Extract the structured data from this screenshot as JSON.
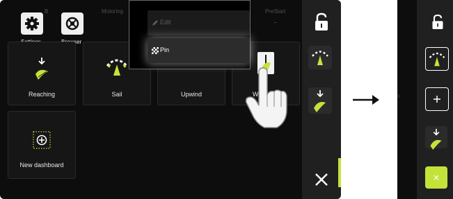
{
  "dashboard": {
    "dim_tabs": [
      "B",
      "Motoring",
      "PreStart"
    ],
    "toolbar": {
      "settings_label": "Settings",
      "browser_label": "Browser"
    },
    "tiles": [
      {
        "label": "Reaching"
      },
      {
        "label": "Sail"
      },
      {
        "label": "Upwind"
      },
      {
        "label": "Windrace"
      },
      {
        "label": "New dashboard"
      }
    ]
  },
  "context_menu": {
    "edit_label": "Edit",
    "pin_label": "Pin"
  },
  "second_screen": {
    "dim_text": "s"
  },
  "colors": {
    "accent": "#c3e33a",
    "bar": "#202020",
    "tile": "#161616"
  }
}
